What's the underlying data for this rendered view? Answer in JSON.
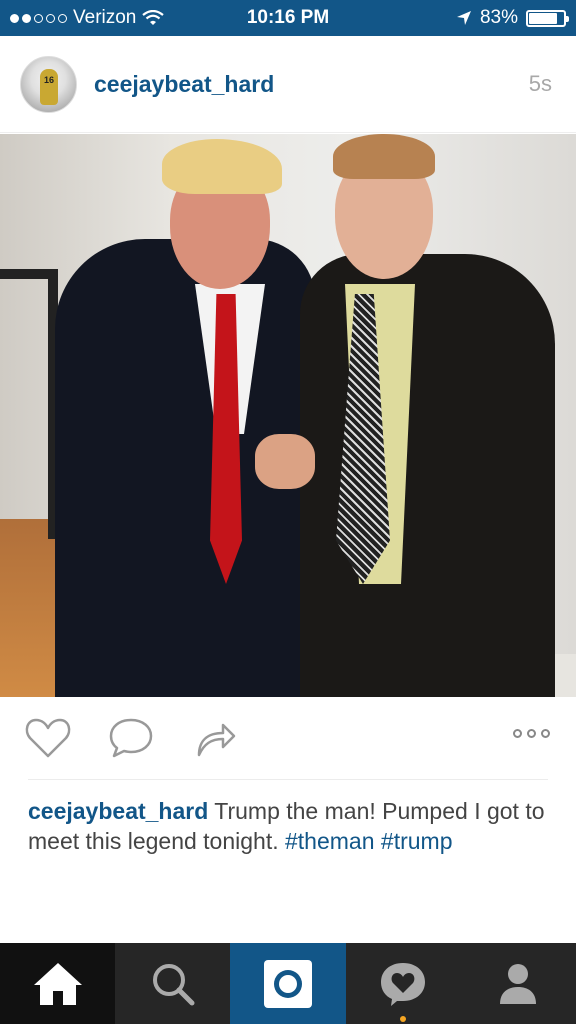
{
  "status_bar": {
    "carrier": "Verizon",
    "signal_bars_filled": 2,
    "signal_bars_total": 5,
    "time": "10:16 PM",
    "battery_percent": "83%",
    "battery_level": 0.83
  },
  "post": {
    "username": "ceejaybeat_hard",
    "time_ago": "5s",
    "avatar_jersey_number": "16",
    "caption": {
      "username": "ceejaybeat_hard",
      "text": "Trump the man! Pumped I got to meet this legend tonight.",
      "hashtags": [
        "#theman",
        "#trump"
      ]
    }
  },
  "colors": {
    "brand_blue": "#125688",
    "tabbar_bg": "#262626",
    "notification": "#f5a623"
  },
  "tabs": [
    {
      "name": "home",
      "icon": "home-icon"
    },
    {
      "name": "search",
      "icon": "search-icon"
    },
    {
      "name": "camera",
      "icon": "camera-icon"
    },
    {
      "name": "activity",
      "icon": "heart-bubble-icon"
    },
    {
      "name": "profile",
      "icon": "profile-icon"
    }
  ]
}
